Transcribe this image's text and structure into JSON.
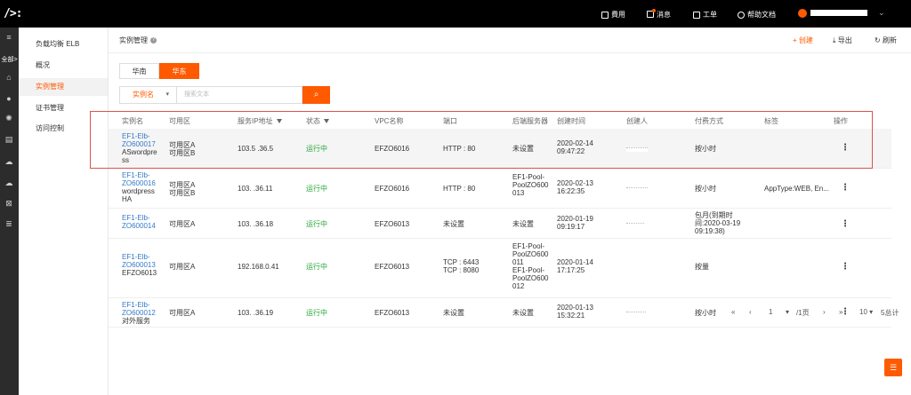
{
  "topbar": {
    "logo": "/>:",
    "nav": [
      {
        "label": "費用",
        "icon": "bill-icon"
      },
      {
        "label": "消息",
        "icon": "message-icon"
      },
      {
        "label": "工单",
        "icon": "ticket-icon"
      },
      {
        "label": "帮助文档",
        "icon": "help-icon"
      }
    ],
    "accent": "#ff5a00"
  },
  "leftnav": {
    "all_label": "全部>"
  },
  "sidebar": {
    "title": "负载均衡 ELB",
    "items": [
      {
        "label": "概况"
      },
      {
        "label": "实例管理"
      },
      {
        "label": "证书管理"
      },
      {
        "label": "访问控制"
      }
    ]
  },
  "header": {
    "title": "实例管理",
    "create": "创建",
    "export": "导出",
    "refresh": "刷新"
  },
  "regions": [
    "华南",
    "华东"
  ],
  "search": {
    "field": "实例名",
    "placeholder": "搜索文本"
  },
  "table": {
    "columns": [
      "实例名",
      "可用区",
      "服务IP地址",
      "状态",
      "VPC名称",
      "端口",
      "后端服务器",
      "创建时间",
      "创建人",
      "付费方式",
      "标签",
      "操作"
    ],
    "rows": [
      {
        "name": "EF1-Elb-\nZO600017",
        "desc": "ASwordpre\nss",
        "zone": "可用区A\n可用区B",
        "ip": "103.5  .36.5",
        "status": "运行中",
        "vpc": "EFZO6016",
        "port": "HTTP : 80",
        "backend": "未设置",
        "created": "2020-02-14\n09:47:22",
        "pay": "按小时",
        "tags": ""
      },
      {
        "name": "EF1-Elb-\nZO600016",
        "desc": "wordpress\nHA",
        "zone": "可用区A\n可用区B",
        "ip": "103.  .36.11",
        "status": "运行中",
        "vpc": "EFZO6016",
        "port": "HTTP : 80",
        "backend": "EF1-Pool-\nPoolZO600\n013",
        "created": "2020-02-13\n16:22:35",
        "pay": "按小时",
        "tags": "AppType:WEB, En..."
      },
      {
        "name": "EF1-Elb-\nZO600014",
        "desc": "",
        "zone": "可用区A",
        "ip": "103.  .36.18",
        "status": "运行中",
        "vpc": "EFZO6013",
        "port": "未设置",
        "backend": "未设置",
        "created": "2020-01-19\n09:19:17",
        "pay": "包月(到期时\n间:2020-03-19\n09:19:38)",
        "tags": ""
      },
      {
        "name": "EF1-Elb-\nZO600013",
        "desc": "EFZO6013",
        "zone": "可用区A",
        "ip": "192.168.0.41",
        "status": "运行中",
        "vpc": "EFZO6013",
        "port": "TCP : 6443\nTCP : 8080",
        "backend": "EF1-Pool-\nPoolZO600\n011\nEF1-Pool-\nPoolZO600\n012",
        "created": "2020-01-14\n17:17:25",
        "pay": "按量",
        "tags": ""
      },
      {
        "name": "EF1-Elb-\nZO600012",
        "desc": "对外服务",
        "zone": "可用区A",
        "ip": "103.  .36.19",
        "status": "运行中",
        "vpc": "EFZO6013",
        "port": "未设置",
        "backend": "未设置",
        "created": "2020-01-13\n15:32:21",
        "pay": "按小时",
        "tags": ""
      }
    ]
  },
  "pagination": {
    "first": "«",
    "prev": "‹",
    "current": "1",
    "total": "/1页",
    "next": "›",
    "last": "»",
    "page_size": "10",
    "total_count": "5总计"
  }
}
